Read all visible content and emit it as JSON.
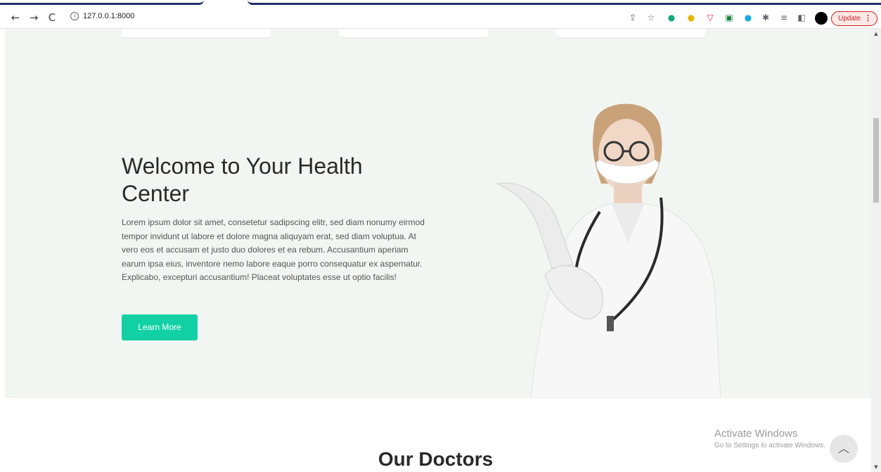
{
  "browser": {
    "url": "127.0.0.1:8000",
    "update_label": "Update",
    "more_menu_glyph": "⋮",
    "nav": {
      "back_icon": "←",
      "forward_icon": "→",
      "reload_icon": "C"
    },
    "extensions": [
      {
        "name": "share-icon",
        "glyph": "⇪"
      },
      {
        "name": "bookmark-star-icon",
        "glyph": "☆"
      },
      {
        "name": "extension-green-icon",
        "glyph": "●",
        "color": "#18a87a"
      },
      {
        "name": "extension-yellow-icon",
        "glyph": "●",
        "color": "#e8b400"
      },
      {
        "name": "pocket-icon",
        "glyph": "▽",
        "color": "#e0245e"
      },
      {
        "name": "extension-box-icon",
        "glyph": "▣",
        "color": "#188038"
      },
      {
        "name": "extension-blue-icon",
        "glyph": "●",
        "color": "#1ba8e0"
      },
      {
        "name": "puzzle-icon",
        "glyph": "✱"
      },
      {
        "name": "reading-list-icon",
        "glyph": "≡"
      },
      {
        "name": "side-panel-icon",
        "glyph": "◧"
      }
    ]
  },
  "hero": {
    "title": "Welcome to Your Health Center",
    "body": "Lorem ipsum dolor sit amet, consetetur sadipscing elitr, sed diam nonumy eirmod tempor invidunt ut labore et dolore magna aliquyam erat, sed diam voluptua. At vero eos et accusam et justo duo dolores et ea rebum. Accusantium aperiam earum ipsa eius, inventore nemo labore eaque porro consequatur ex aspernatur. Explicabo, excepturi accusantium! Placeat voluptates esse ut optio facilis!",
    "cta_label": "Learn More"
  },
  "doctors_section": {
    "title": "Our Doctors"
  },
  "windows_watermark": {
    "line1": "Activate Windows",
    "line2": "Go to Settings to activate Windows."
  },
  "colors": {
    "accent": "#11d1a4",
    "hero_bg": "#f1f6f3",
    "update_red": "#c5221f"
  }
}
